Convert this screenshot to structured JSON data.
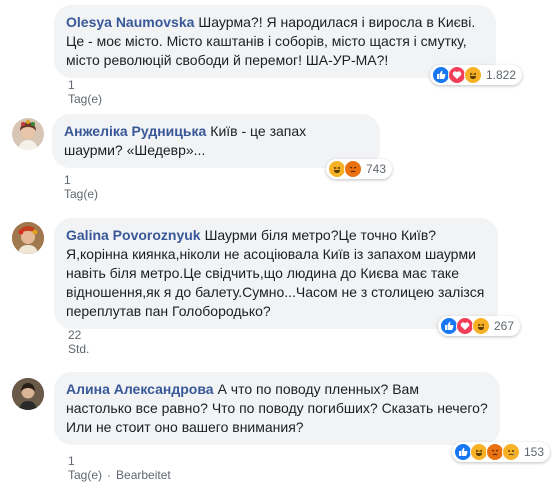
{
  "comments": [
    {
      "author": "Olesya Naumovska",
      "text": "Шаурма?! Я народилася і виросла в Києві. Це - моє місто. Місто каштанів і соборів, місто щастя і смутку, місто революцій свободи й перемог! ША-УР-МА?!",
      "meta": "1 Tag(e)",
      "reaction_count": "1.822",
      "reactions": [
        "like-icon",
        "love-icon",
        "haha-icon"
      ]
    },
    {
      "author": "Анжеліка Рудницька",
      "text": "Київ - це запах шаурми? «Шедевр»...",
      "meta": "1 Tag(e)",
      "reaction_count": "743",
      "reactions": [
        "haha-icon",
        "angry-icon"
      ]
    },
    {
      "author": "Galina Povoroznyuk",
      "text": "Шаурми біля метро?Це точно Київ? Я,корінна киянка,ніколи не асоціювала Київ із запахом шаурми навіть біля метро.Це свідчить,що людина до Києва має таке відношення,як я до балету.Сумно...Часом не з столицею залізся переплутав пан Голобородько?",
      "meta": "22 Std.",
      "reaction_count": "267",
      "reactions": [
        "like-icon",
        "love-icon",
        "haha-icon"
      ]
    },
    {
      "author": "Алина Александрова",
      "text": "А что по поводу пленных? Вам настолько все равно? Что по поводу погибших? Сказать нечего? Или не стоит оно вашего внимания?",
      "meta": "1 Tag(e)",
      "meta_extra": "Bearbeitet",
      "reaction_count": "153",
      "reactions": [
        "like-icon",
        "haha-icon",
        "angry-icon",
        "sad-icon"
      ]
    }
  ],
  "colors": {
    "author": "#385898",
    "bubble": "#f2f3f5",
    "like": "#1877f2",
    "love": "#f33e58",
    "haha": "#f7b125",
    "angry": "#e9710f"
  }
}
